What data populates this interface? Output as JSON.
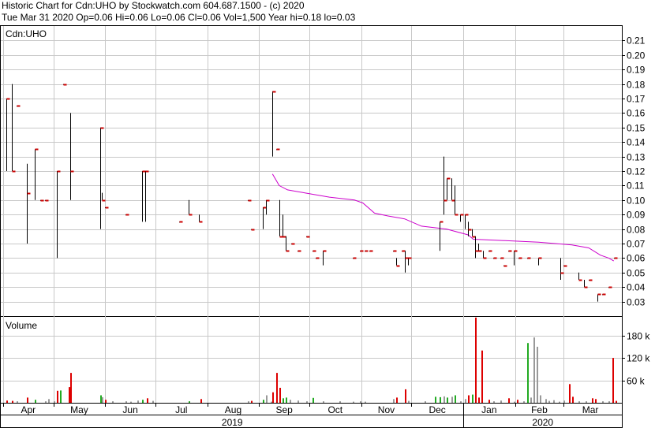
{
  "header": {
    "title": "Historic Chart for Cdn:UHO by Stockwatch.com 604.687.1500 - (c) 2020",
    "quote": "Tue Mar 31 2020  Op=0.06  Hi=0.06  Lo=0.06  Cl=0.06  Vol=1,500  Year hi=0.18  lo=0.03"
  },
  "price_panel": {
    "label": "Cdn:UHO"
  },
  "volume_panel": {
    "label": "Volume"
  },
  "colors": {
    "price_bar": "#000000",
    "tick": "#cc0000",
    "moving_average": "#cc00cc",
    "vol_up": "#22aa22",
    "vol_down": "#dd0000",
    "vol_flat": "#999999",
    "grid": "#c8c8c8",
    "frame": "#000000"
  },
  "chart_data": [
    {
      "type": "ohlc",
      "panel": "price",
      "title": "Cdn:UHO",
      "y_ticks": [
        0.03,
        0.04,
        0.05,
        0.06,
        0.07,
        0.08,
        0.09,
        0.1,
        0.11,
        0.12,
        0.13,
        0.14,
        0.15,
        0.16,
        0.17,
        0.18,
        0.19,
        0.2,
        0.21
      ],
      "y_tick_labels": [
        "0.03",
        "0.04",
        "0.05",
        "0.06",
        "0.07",
        "0.08",
        "0.09",
        "0.10",
        "0.11",
        "0.12",
        "0.13",
        "0.14",
        "0.15",
        "0.16",
        "0.17",
        "0.18",
        "0.19",
        "0.20",
        "0.21"
      ],
      "ylim": [
        0.02,
        0.22
      ],
      "x_months": [
        "Apr",
        "May",
        "Jun",
        "Jul",
        "Aug",
        "Sep",
        "Oct",
        "Nov",
        "Dec",
        "Jan",
        "Feb",
        "Mar"
      ],
      "x_years": [
        "2019",
        "2020"
      ],
      "x_range_days": [
        0,
        367
      ],
      "month_start_days": [
        0,
        30,
        61,
        91,
        122,
        153,
        183,
        214,
        244,
        275,
        306,
        335
      ],
      "bars": [
        {
          "d": 2,
          "h": 0.17,
          "l": 0.12,
          "c": 0.17
        },
        {
          "d": 5,
          "h": 0.18,
          "l": 0.12,
          "c": 0.12
        },
        {
          "d": 8,
          "h": 0.165,
          "l": 0.165,
          "c": 0.165
        },
        {
          "d": 14,
          "h": 0.125,
          "l": 0.07,
          "c": 0.105
        },
        {
          "d": 19,
          "h": 0.135,
          "l": 0.1,
          "c": 0.135
        },
        {
          "d": 22,
          "h": 0.1,
          "l": 0.1,
          "c": 0.1
        },
        {
          "d": 25,
          "h": 0.1,
          "l": 0.1,
          "c": 0.1
        },
        {
          "d": 32,
          "h": 0.12,
          "l": 0.06,
          "c": 0.12
        },
        {
          "d": 36,
          "h": 0.18,
          "l": 0.18,
          "c": 0.18
        },
        {
          "d": 40,
          "h": 0.16,
          "l": 0.1,
          "c": 0.12
        },
        {
          "d": 58,
          "h": 0.15,
          "l": 0.08,
          "c": 0.15
        },
        {
          "d": 59,
          "h": 0.105,
          "l": 0.1,
          "c": 0.1
        },
        {
          "d": 61,
          "h": 0.095,
          "l": 0.095,
          "c": 0.095
        },
        {
          "d": 73,
          "h": 0.09,
          "l": 0.09,
          "c": 0.09
        },
        {
          "d": 83,
          "h": 0.12,
          "l": 0.085,
          "c": 0.12
        },
        {
          "d": 85,
          "h": 0.12,
          "l": 0.085,
          "c": 0.12
        },
        {
          "d": 105,
          "h": 0.085,
          "l": 0.085,
          "c": 0.085
        },
        {
          "d": 111,
          "h": 0.1,
          "l": 0.09,
          "c": 0.09
        },
        {
          "d": 117,
          "h": 0.09,
          "l": 0.085,
          "c": 0.085
        },
        {
          "d": 146,
          "h": 0.1,
          "l": 0.1,
          "c": 0.1
        },
        {
          "d": 148,
          "h": 0.08,
          "l": 0.08,
          "c": 0.08
        },
        {
          "d": 155,
          "h": 0.095,
          "l": 0.08,
          "c": 0.095
        },
        {
          "d": 157,
          "h": 0.1,
          "l": 0.09,
          "c": 0.1
        },
        {
          "d": 161,
          "h": 0.175,
          "l": 0.13,
          "c": 0.175
        },
        {
          "d": 163,
          "h": 0.135,
          "l": 0.135,
          "c": 0.135
        },
        {
          "d": 165,
          "h": 0.1,
          "l": 0.075,
          "c": 0.075
        },
        {
          "d": 167,
          "h": 0.09,
          "l": 0.075,
          "c": 0.075
        },
        {
          "d": 169,
          "h": 0.075,
          "l": 0.065,
          "c": 0.065
        },
        {
          "d": 172,
          "h": 0.07,
          "l": 0.07,
          "c": 0.07
        },
        {
          "d": 176,
          "h": 0.065,
          "l": 0.065,
          "c": 0.065
        },
        {
          "d": 181,
          "h": 0.075,
          "l": 0.075,
          "c": 0.075
        },
        {
          "d": 185,
          "h": 0.065,
          "l": 0.065,
          "c": 0.065
        },
        {
          "d": 187,
          "h": 0.06,
          "l": 0.06,
          "c": 0.06
        },
        {
          "d": 191,
          "h": 0.065,
          "l": 0.055,
          "c": 0.065
        },
        {
          "d": 209,
          "h": 0.06,
          "l": 0.06,
          "c": 0.06
        },
        {
          "d": 213,
          "h": 0.065,
          "l": 0.065,
          "c": 0.065
        },
        {
          "d": 216,
          "h": 0.065,
          "l": 0.065,
          "c": 0.065
        },
        {
          "d": 219,
          "h": 0.065,
          "l": 0.065,
          "c": 0.065
        },
        {
          "d": 233,
          "h": 0.065,
          "l": 0.065,
          "c": 0.065
        },
        {
          "d": 235,
          "h": 0.06,
          "l": 0.055,
          "c": 0.055
        },
        {
          "d": 238,
          "h": 0.065,
          "l": 0.065,
          "c": 0.065
        },
        {
          "d": 240,
          "h": 0.065,
          "l": 0.05,
          "c": 0.06
        },
        {
          "d": 242,
          "h": 0.06,
          "l": 0.055,
          "c": 0.06
        },
        {
          "d": 261,
          "h": 0.085,
          "l": 0.065,
          "c": 0.085
        },
        {
          "d": 263,
          "h": 0.13,
          "l": 0.09,
          "c": 0.1
        },
        {
          "d": 265,
          "h": 0.115,
          "l": 0.1,
          "c": 0.115
        },
        {
          "d": 268,
          "h": 0.115,
          "l": 0.1,
          "c": 0.1
        },
        {
          "d": 270,
          "h": 0.11,
          "l": 0.09,
          "c": 0.09
        },
        {
          "d": 273,
          "h": 0.09,
          "l": 0.085,
          "c": 0.09
        },
        {
          "d": 276,
          "h": 0.09,
          "l": 0.08,
          "c": 0.09
        },
        {
          "d": 278,
          "h": 0.085,
          "l": 0.075,
          "c": 0.08
        },
        {
          "d": 280,
          "h": 0.08,
          "l": 0.075,
          "c": 0.075
        },
        {
          "d": 282,
          "h": 0.075,
          "l": 0.06,
          "c": 0.065
        },
        {
          "d": 284,
          "h": 0.07,
          "l": 0.065,
          "c": 0.065
        },
        {
          "d": 287,
          "h": 0.065,
          "l": 0.06,
          "c": 0.06
        },
        {
          "d": 290,
          "h": 0.065,
          "l": 0.065,
          "c": 0.065
        },
        {
          "d": 293,
          "h": 0.06,
          "l": 0.06,
          "c": 0.06
        },
        {
          "d": 297,
          "h": 0.06,
          "l": 0.06,
          "c": 0.06
        },
        {
          "d": 299,
          "h": 0.055,
          "l": 0.055,
          "c": 0.055
        },
        {
          "d": 302,
          "h": 0.065,
          "l": 0.065,
          "c": 0.065
        },
        {
          "d": 305,
          "h": 0.065,
          "l": 0.055,
          "c": 0.065
        },
        {
          "d": 308,
          "h": 0.06,
          "l": 0.06,
          "c": 0.06
        },
        {
          "d": 313,
          "h": 0.06,
          "l": 0.06,
          "c": 0.06
        },
        {
          "d": 320,
          "h": 0.06,
          "l": 0.055,
          "c": 0.06
        },
        {
          "d": 333,
          "h": 0.06,
          "l": 0.045,
          "c": 0.05
        },
        {
          "d": 335,
          "h": 0.055,
          "l": 0.055,
          "c": 0.055
        },
        {
          "d": 344,
          "h": 0.05,
          "l": 0.045,
          "c": 0.045
        },
        {
          "d": 347,
          "h": 0.045,
          "l": 0.04,
          "c": 0.04
        },
        {
          "d": 350,
          "h": 0.045,
          "l": 0.045,
          "c": 0.045
        },
        {
          "d": 355,
          "h": 0.035,
          "l": 0.03,
          "c": 0.035
        },
        {
          "d": 358,
          "h": 0.035,
          "l": 0.035,
          "c": 0.035
        },
        {
          "d": 362,
          "h": 0.04,
          "l": 0.04,
          "c": 0.04
        },
        {
          "d": 365,
          "h": 0.06,
          "l": 0.06,
          "c": 0.06
        }
      ],
      "moving_average": {
        "x": [
          161,
          165,
          170,
          180,
          195,
          210,
          215,
          222,
          230,
          240,
          250,
          265,
          278,
          281,
          300,
          320,
          340,
          350,
          357,
          362,
          365
        ],
        "y": [
          0.118,
          0.11,
          0.107,
          0.105,
          0.102,
          0.1,
          0.098,
          0.091,
          0.089,
          0.087,
          0.082,
          0.08,
          0.076,
          0.073,
          0.072,
          0.071,
          0.069,
          0.067,
          0.062,
          0.06,
          0.058
        ]
      }
    },
    {
      "type": "bar",
      "panel": "volume",
      "title": "Volume",
      "y_ticks": [
        60000,
        120000,
        180000
      ],
      "y_tick_labels": [
        "60 k",
        "120 k",
        "180 k"
      ],
      "ylim": [
        0,
        230000
      ],
      "volumes": [
        {
          "d": 2,
          "v": 6000,
          "dir": "down"
        },
        {
          "d": 5,
          "v": 5000,
          "dir": "down"
        },
        {
          "d": 8,
          "v": 4000,
          "dir": "flat"
        },
        {
          "d": 14,
          "v": 14000,
          "dir": "down"
        },
        {
          "d": 19,
          "v": 8000,
          "dir": "up"
        },
        {
          "d": 25,
          "v": 4000,
          "dir": "flat"
        },
        {
          "d": 27,
          "v": 10000,
          "dir": "flat"
        },
        {
          "d": 30,
          "v": 4000,
          "dir": "flat"
        },
        {
          "d": 32,
          "v": 32000,
          "dir": "down"
        },
        {
          "d": 34,
          "v": 33000,
          "dir": "up"
        },
        {
          "d": 39,
          "v": 42000,
          "dir": "down"
        },
        {
          "d": 40,
          "v": 80000,
          "dir": "down"
        },
        {
          "d": 58,
          "v": 20000,
          "dir": "up"
        },
        {
          "d": 59,
          "v": 15000,
          "dir": "flat"
        },
        {
          "d": 61,
          "v": 8000,
          "dir": "down"
        },
        {
          "d": 65,
          "v": 4000,
          "dir": "flat"
        },
        {
          "d": 73,
          "v": 4000,
          "dir": "flat"
        },
        {
          "d": 76,
          "v": 3000,
          "dir": "flat"
        },
        {
          "d": 80,
          "v": 6000,
          "dir": "flat"
        },
        {
          "d": 83,
          "v": 8000,
          "dir": "up"
        },
        {
          "d": 86,
          "v": 12000,
          "dir": "down"
        },
        {
          "d": 89,
          "v": 5000,
          "dir": "flat"
        },
        {
          "d": 111,
          "v": 4000,
          "dir": "up"
        },
        {
          "d": 118,
          "v": 10000,
          "dir": "down"
        },
        {
          "d": 146,
          "v": 4000,
          "dir": "flat"
        },
        {
          "d": 148,
          "v": 5000,
          "dir": "down"
        },
        {
          "d": 155,
          "v": 8000,
          "dir": "up"
        },
        {
          "d": 157,
          "v": 20000,
          "dir": "flat"
        },
        {
          "d": 160,
          "v": 3000,
          "dir": "flat"
        },
        {
          "d": 161,
          "v": 28000,
          "dir": "down"
        },
        {
          "d": 163,
          "v": 80000,
          "dir": "down"
        },
        {
          "d": 165,
          "v": 40000,
          "dir": "down"
        },
        {
          "d": 167,
          "v": 12000,
          "dir": "up"
        },
        {
          "d": 169,
          "v": 14000,
          "dir": "up"
        },
        {
          "d": 171,
          "v": 8000,
          "dir": "flat"
        },
        {
          "d": 176,
          "v": 6000,
          "dir": "flat"
        },
        {
          "d": 181,
          "v": 4000,
          "dir": "flat"
        },
        {
          "d": 185,
          "v": 13000,
          "dir": "up"
        },
        {
          "d": 191,
          "v": 4000,
          "dir": "flat"
        },
        {
          "d": 201,
          "v": 4000,
          "dir": "flat"
        },
        {
          "d": 209,
          "v": 3000,
          "dir": "flat"
        },
        {
          "d": 213,
          "v": 4000,
          "dir": "flat"
        },
        {
          "d": 216,
          "v": 3000,
          "dir": "flat"
        },
        {
          "d": 233,
          "v": 10000,
          "dir": "flat"
        },
        {
          "d": 235,
          "v": 14000,
          "dir": "down"
        },
        {
          "d": 240,
          "v": 36000,
          "dir": "down"
        },
        {
          "d": 242,
          "v": 5000,
          "dir": "flat"
        },
        {
          "d": 252,
          "v": 4000,
          "dir": "flat"
        },
        {
          "d": 258,
          "v": 16000,
          "dir": "up"
        },
        {
          "d": 261,
          "v": 15000,
          "dir": "up"
        },
        {
          "d": 263,
          "v": 17000,
          "dir": "flat"
        },
        {
          "d": 265,
          "v": 14000,
          "dir": "up"
        },
        {
          "d": 268,
          "v": 16000,
          "dir": "flat"
        },
        {
          "d": 270,
          "v": 20000,
          "dir": "up"
        },
        {
          "d": 273,
          "v": 4000,
          "dir": "flat"
        },
        {
          "d": 276,
          "v": 10000,
          "dir": "flat"
        },
        {
          "d": 278,
          "v": 20000,
          "dir": "down"
        },
        {
          "d": 280,
          "v": 22000,
          "dir": "up"
        },
        {
          "d": 282,
          "v": 228000,
          "dir": "down"
        },
        {
          "d": 284,
          "v": 14000,
          "dir": "down"
        },
        {
          "d": 286,
          "v": 140000,
          "dir": "down"
        },
        {
          "d": 290,
          "v": 8000,
          "dir": "down"
        },
        {
          "d": 293,
          "v": 4000,
          "dir": "flat"
        },
        {
          "d": 297,
          "v": 6000,
          "dir": "flat"
        },
        {
          "d": 302,
          "v": 12000,
          "dir": "down"
        },
        {
          "d": 305,
          "v": 3000,
          "dir": "flat"
        },
        {
          "d": 307,
          "v": 8000,
          "dir": "down"
        },
        {
          "d": 311,
          "v": 4000,
          "dir": "flat"
        },
        {
          "d": 313,
          "v": 160000,
          "dir": "up"
        },
        {
          "d": 315,
          "v": 14000,
          "dir": "flat"
        },
        {
          "d": 317,
          "v": 175000,
          "dir": "flat"
        },
        {
          "d": 319,
          "v": 150000,
          "dir": "flat"
        },
        {
          "d": 321,
          "v": 20000,
          "dir": "flat"
        },
        {
          "d": 324,
          "v": 10000,
          "dir": "flat"
        },
        {
          "d": 326,
          "v": 5000,
          "dir": "flat"
        },
        {
          "d": 329,
          "v": 7000,
          "dir": "flat"
        },
        {
          "d": 332,
          "v": 3000,
          "dir": "flat"
        },
        {
          "d": 335,
          "v": 6000,
          "dir": "flat"
        },
        {
          "d": 338,
          "v": 50000,
          "dir": "down"
        },
        {
          "d": 340,
          "v": 16000,
          "dir": "down"
        },
        {
          "d": 344,
          "v": 4000,
          "dir": "flat"
        },
        {
          "d": 348,
          "v": 4000,
          "dir": "flat"
        },
        {
          "d": 352,
          "v": 12000,
          "dir": "down"
        },
        {
          "d": 354,
          "v": 10000,
          "dir": "down"
        },
        {
          "d": 358,
          "v": 4000,
          "dir": "flat"
        },
        {
          "d": 362,
          "v": 4000,
          "dir": "flat"
        },
        {
          "d": 364,
          "v": 120000,
          "dir": "down"
        },
        {
          "d": 366,
          "v": 5000,
          "dir": "down"
        }
      ]
    }
  ]
}
